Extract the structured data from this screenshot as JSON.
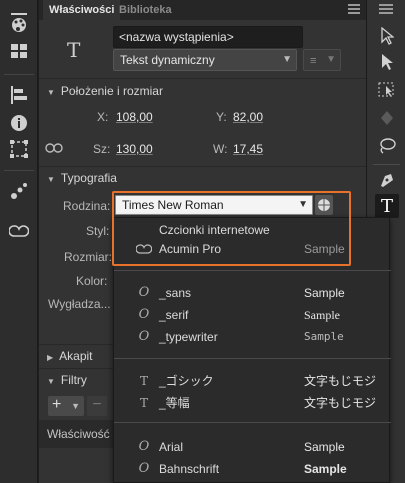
{
  "tabs": [
    {
      "label": "Właściwości"
    },
    {
      "label": "Biblioteka"
    }
  ],
  "instance": {
    "name_placeholder": "<nazwa wystąpienia>",
    "text_type": "Tekst dynamiczny"
  },
  "position": {
    "title": "Położenie i rozmiar",
    "x_label": "X:",
    "x_value": "108,00",
    "y_label": "Y:",
    "y_value": "82,00",
    "w_label": "Sz:",
    "w_value": "130,00",
    "h_label": "W:",
    "h_value": "17,45"
  },
  "typography": {
    "title": "Typografia",
    "family_label": "Rodzina:",
    "family_value": "Times New Roman",
    "style_label": "Styl:",
    "size_label": "Rozmiar:",
    "color_label": "Kolor:",
    "smoothing_label": "Wygładza..."
  },
  "sections": {
    "akapit": "Akapit",
    "filtry": "Filtry"
  },
  "bottom_tab": "Właściwość",
  "dropdown": {
    "web_fonts_header": "Czcionki internetowe",
    "fonts": [
      {
        "icon": "cloud-font-icon",
        "name": "Acumin Pro",
        "sample": "Sample"
      },
      {
        "icon": "italic-o-icon",
        "name": "_sans",
        "sample": "Sample"
      },
      {
        "icon": "italic-o-icon",
        "name": "_serif",
        "sample": "Sample"
      },
      {
        "icon": "italic-o-icon",
        "name": "_typewriter",
        "sample": "Sample"
      },
      {
        "icon": "truetype-icon",
        "name": "_ゴシック",
        "sample": "文字もじモジ"
      },
      {
        "icon": "truetype-icon",
        "name": "_等幅",
        "sample": "文字もじモジ"
      },
      {
        "icon": "italic-o-icon",
        "name": "Arial",
        "sample": "Sample"
      },
      {
        "icon": "italic-o-icon",
        "name": "Bahnschrift",
        "sample": "Sample"
      }
    ]
  },
  "colors": {
    "highlight": "#e8722a"
  }
}
